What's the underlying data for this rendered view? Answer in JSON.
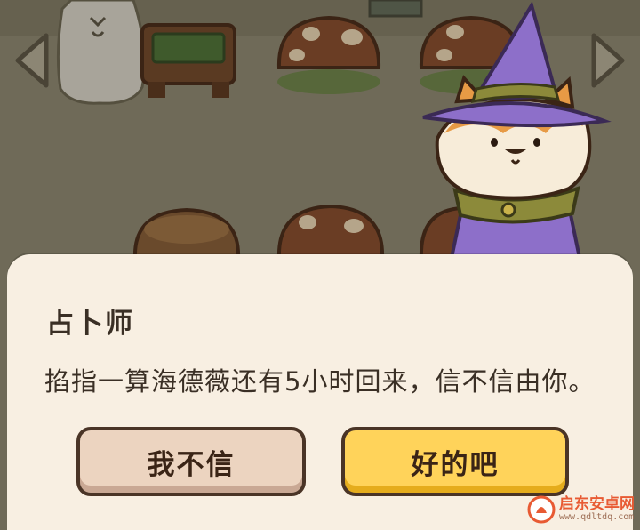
{
  "dialog": {
    "speaker": "占卜师",
    "message": "掐指一算海德薇还有5小时回来，信不信由你。",
    "buttons": {
      "decline": "我不信",
      "accept": "好的吧"
    }
  },
  "scene": {
    "nav_left_icon": "arrow-left-icon",
    "nav_right_icon": "arrow-right-icon",
    "characters": [
      "fortune-teller-fox",
      "gray-cat"
    ],
    "colors": {
      "background": "#6f6a58",
      "dialog": "#f8efe2",
      "accept_button": "#ffd35a",
      "decline_button": "#ecd4c0",
      "witch_purple": "#8d6fc9"
    }
  },
  "watermark": {
    "title": "启东安卓网",
    "url": "www.qdltdq.com"
  }
}
